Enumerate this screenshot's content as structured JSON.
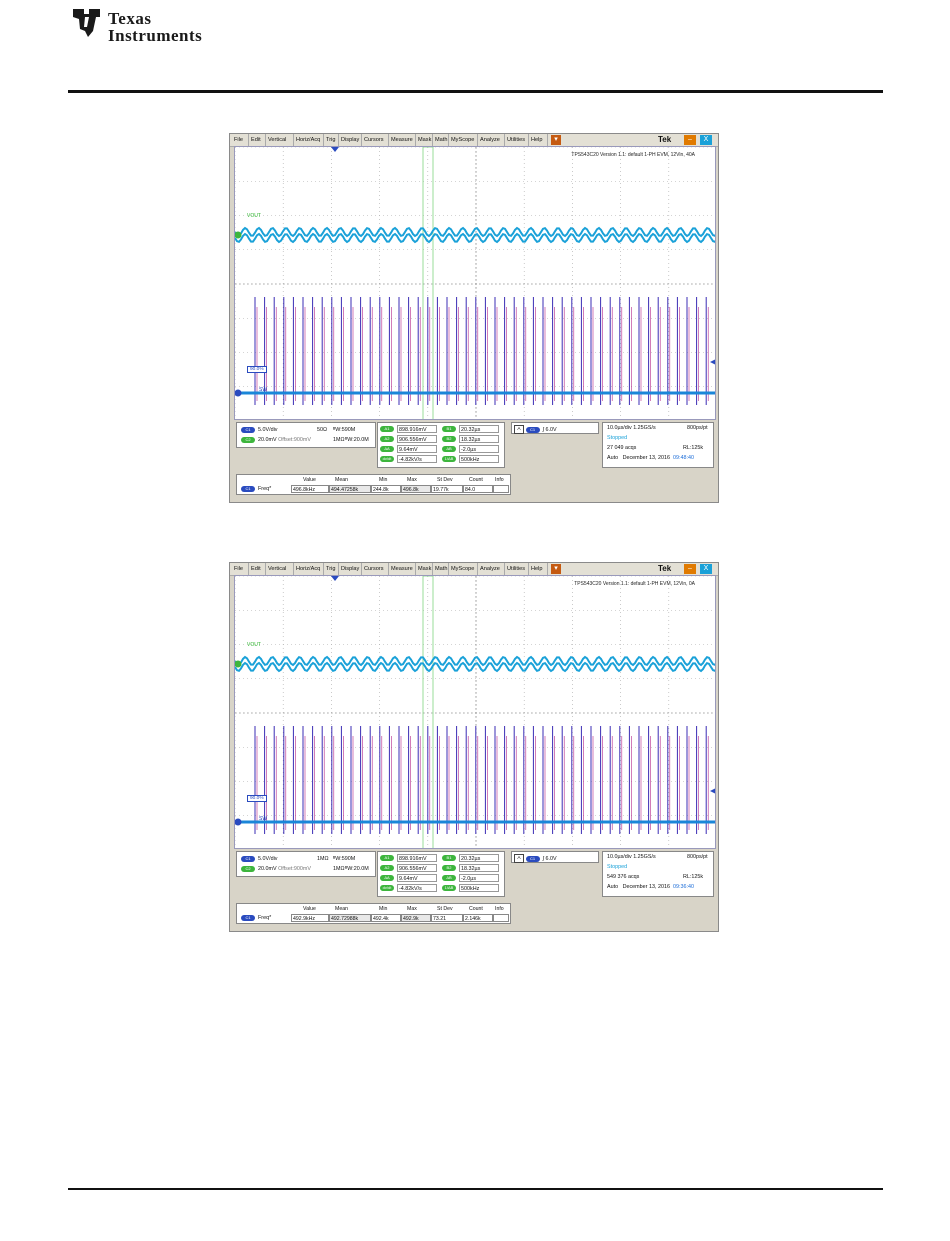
{
  "header": {
    "logo_text_line1": "Texas",
    "logo_text_line2": "Instruments"
  },
  "scopes": [
    {
      "menu": [
        "File",
        "Edit",
        "Vertical",
        "Horiz/Acq",
        "Trig",
        "Display",
        "Cursors",
        "Measure",
        "Mask",
        "Math",
        "MyScope",
        "Analyze",
        "Utilities",
        "Help"
      ],
      "brand": "Tek",
      "config_text": "TPS543C20 Version 1.1: default 1-PH EVM, 12Vin, 40A",
      "vout_label": "VOUT",
      "sw_label": "SW",
      "ref_label": "90.0%",
      "ch1": {
        "name": "C1",
        "scale": "5.0V/div",
        "coupling": "50Ω",
        "bw": "ᴮW:590M"
      },
      "ch2": {
        "name": "C2",
        "scale": "20.0mV",
        "offset": "Offset:900mV",
        "coupling": "1MΩ",
        "bw": "ᴮW:20.0M"
      },
      "measures_a": [
        {
          "label": "A1",
          "value": "898.916mV"
        },
        {
          "label": "A2",
          "value": "906.556mV"
        },
        {
          "label": "ΔA",
          "value": "9.64mV"
        },
        {
          "label": "dv/dt",
          "value": "-4.82kV/s"
        }
      ],
      "measures_b": [
        {
          "label": "B1",
          "value": "20.32µs"
        },
        {
          "label": "B2",
          "value": "18.32µs"
        },
        {
          "label": "ΔB",
          "value": "-2.0µs"
        },
        {
          "label": "1/ΔB",
          "value": "500kHz"
        }
      ],
      "trigger": {
        "source": "A",
        "ch": "C1",
        "level": "6.0V"
      },
      "horizontal": {
        "time_div": "10.0µs/div",
        "sample_rate": "1.25GS/s",
        "resolution": "800ps/pt",
        "status": "Stopped",
        "acqs": "27 049 acqs",
        "record_length": "RL:125k",
        "mode": "Auto",
        "date": "December 13, 2016",
        "time": "09:48:40"
      },
      "stats": {
        "headers": [
          "Value",
          "Mean",
          "Min",
          "Max",
          "St Dev",
          "Count",
          "Info"
        ],
        "row_label": "Freq*",
        "row_ch": "C1",
        "values": [
          "496.8kHz",
          "494.47258k",
          "244.8k",
          "496.8k",
          "19.77k",
          "84.0",
          ""
        ]
      }
    },
    {
      "menu": [
        "File",
        "Edit",
        "Vertical",
        "Horiz/Acq",
        "Trig",
        "Display",
        "Cursors",
        "Measure",
        "Mask",
        "Math",
        "MyScope",
        "Analyze",
        "Utilities",
        "Help"
      ],
      "brand": "Tek",
      "config_text": "TPS543C20 Version 1.1: default 1-PH EVM, 12Vin, 0A",
      "vout_label": "VOUT",
      "sw_label": "SW",
      "ref_label": "90.0%",
      "ch1": {
        "name": "C1",
        "scale": "5.0V/div",
        "coupling": "1MΩ",
        "bw": "ᴮW:590M"
      },
      "ch2": {
        "name": "C2",
        "scale": "20.0mV",
        "offset": "Offset:900mV",
        "coupling": "1MΩ",
        "bw": "ᴮW:20.0M"
      },
      "measures_a": [
        {
          "label": "A1",
          "value": "898.916mV"
        },
        {
          "label": "A2",
          "value": "906.556mV"
        },
        {
          "label": "ΔA",
          "value": "9.64mV"
        },
        {
          "label": "dv/dt",
          "value": "-4.82kV/s"
        }
      ],
      "measures_b": [
        {
          "label": "B1",
          "value": "20.32µs"
        },
        {
          "label": "B2",
          "value": "18.32µs"
        },
        {
          "label": "ΔB",
          "value": "-2.0µs"
        },
        {
          "label": "1/ΔB",
          "value": "500kHz"
        }
      ],
      "trigger": {
        "source": "A",
        "ch": "C1",
        "level": "6.0V"
      },
      "horizontal": {
        "time_div": "10.0µs/div",
        "sample_rate": "1.25GS/s",
        "resolution": "800ps/pt",
        "status": "Stopped",
        "acqs": "549 376 acqs",
        "record_length": "RL:125k",
        "mode": "Auto",
        "date": "December 13, 2016",
        "time": "09:36:40"
      },
      "stats": {
        "headers": [
          "Value",
          "Mean",
          "Min",
          "Max",
          "St Dev",
          "Count",
          "Info"
        ],
        "row_label": "Freq*",
        "row_ch": "C1",
        "values": [
          "492.9kHz",
          "492.72988k",
          "492.4k",
          "492.9k",
          "73.21",
          "2.146k",
          ""
        ]
      }
    }
  ],
  "colors": {
    "vout": "#1aa1d8",
    "sw_primary": "#3b2db5",
    "sw_secondary": "#b5268a",
    "baseline": "#1a86d8",
    "grid": "#a9a9a9",
    "cursor": "#7fd47f"
  }
}
